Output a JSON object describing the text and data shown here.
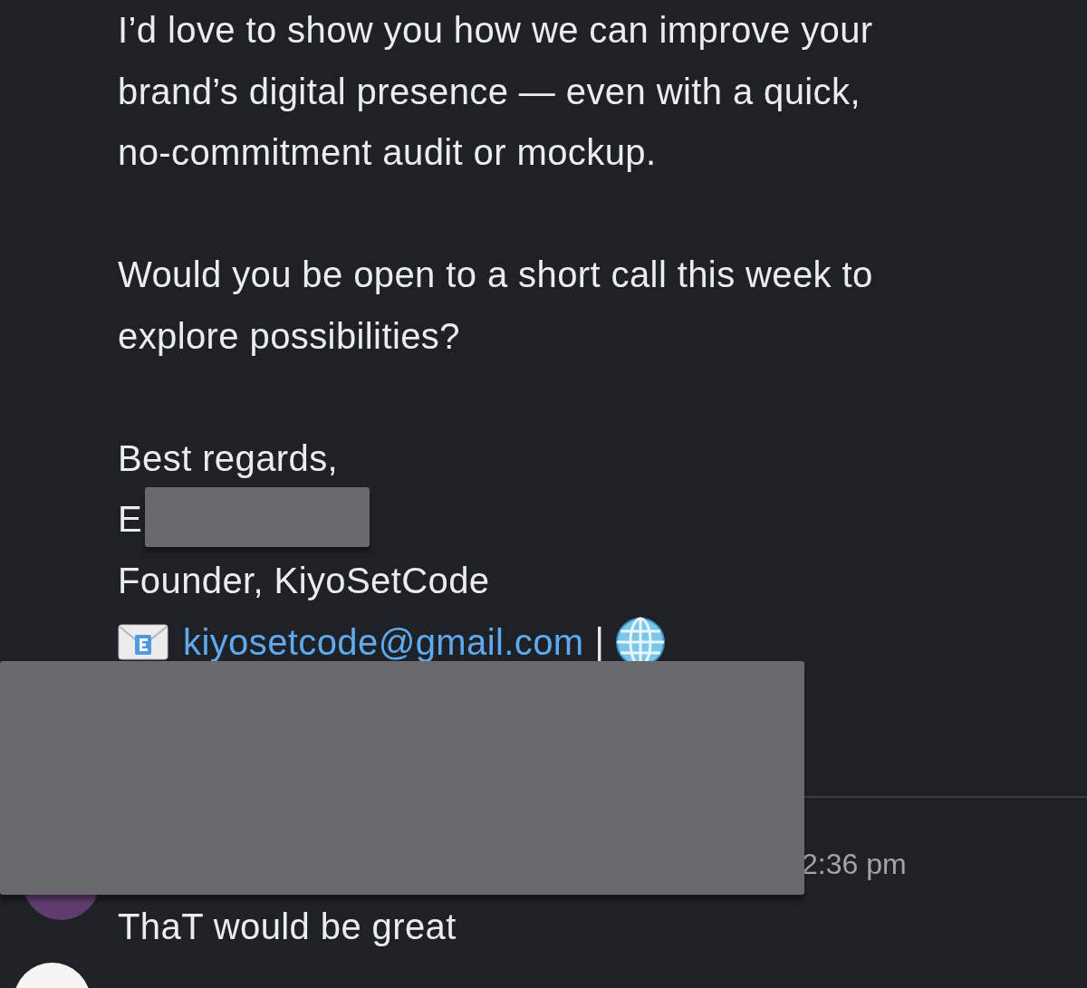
{
  "email": {
    "paragraphs": [
      [
        "I’d love to show you how we can improve your",
        "brand’s digital presence — even with a quick,",
        "no-commitment audit or mockup."
      ],
      [
        "Would you be open to a short call this week to",
        "explore possibilities?"
      ]
    ],
    "signature": {
      "closing": "Best regards,",
      "name_visible": "E",
      "title": "Founder, KiyoSetCode",
      "email": "kiyosetcode@gmail.com",
      "separator": "|"
    }
  },
  "reply": {
    "time": "2:36 pm",
    "text": "ThaT would be great"
  }
}
